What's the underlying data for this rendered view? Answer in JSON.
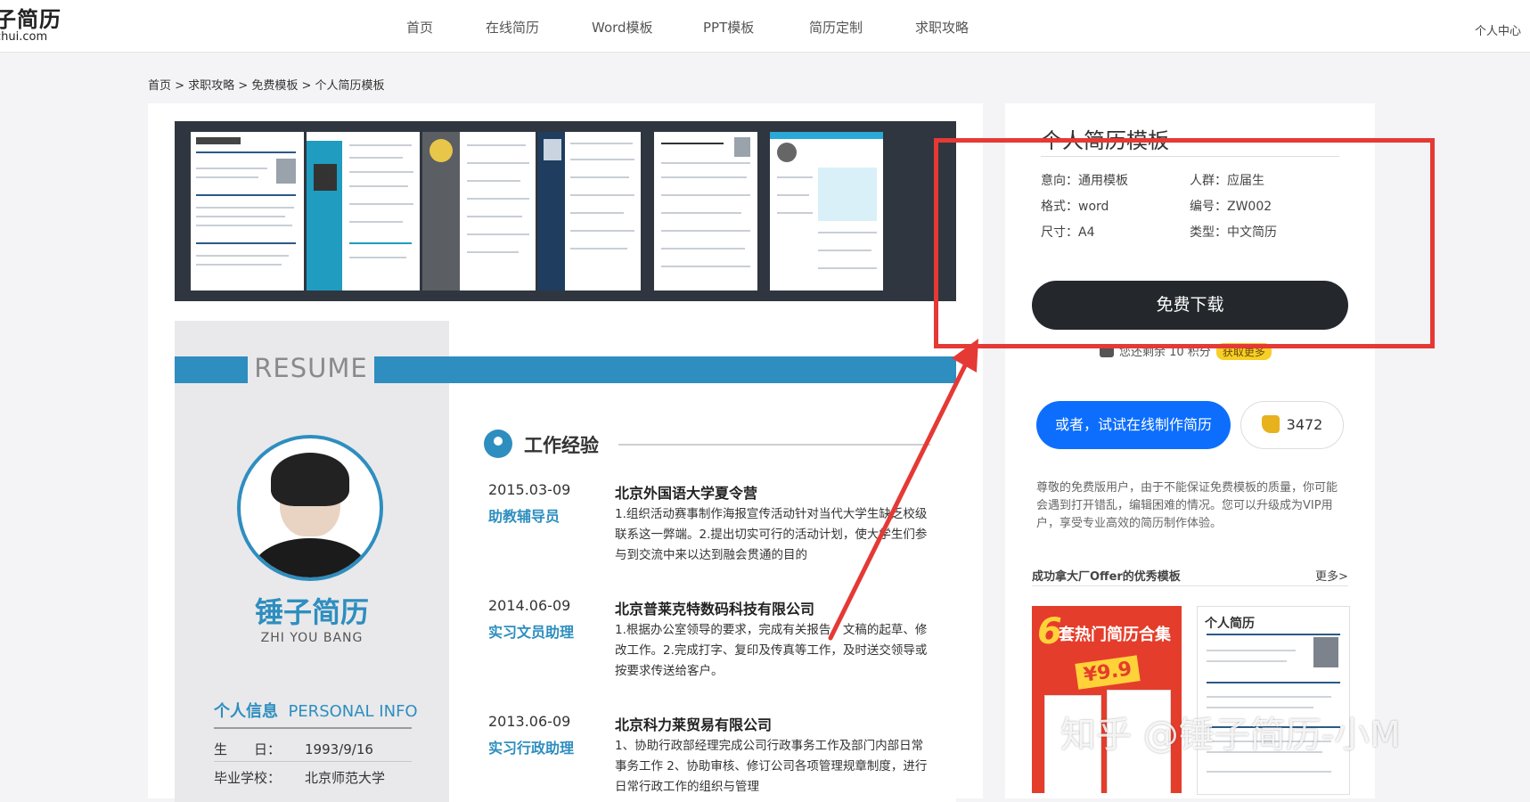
{
  "header": {
    "logo_cn": "子简历",
    "logo_en": "chui.com",
    "nav": [
      "首页",
      "在线简历",
      "Word模板",
      "PPT模板",
      "简历定制",
      "求职攻略"
    ],
    "user_center": "个人中心"
  },
  "breadcrumb": "首页 > 求职攻略 > 免费模板 > 个人简历模板",
  "preview": {
    "resume_word": "RESUME",
    "name": "锤子简历",
    "name_en": "ZHI YOU BANG",
    "info_title_cn": "个人信息",
    "info_title_en": "PERSONAL INFO",
    "info_rows": [
      {
        "k": "生　　日：",
        "v": "1993/9/16"
      },
      {
        "k": "毕业学校：",
        "v": "北京师范大学"
      }
    ],
    "section_title": "工作经验",
    "jobs": [
      {
        "date": "2015.03-09",
        "role": "助教辅导员",
        "company": "北京外国语大学夏令营",
        "desc": "1.组织活动赛事制作海报宣传活动针对当代大学生缺乏校级联系这一弊端。2.提出切实可行的活动计划，使大学生们参与到交流中来以达到融会贯通的目的"
      },
      {
        "date": "2014.06-09",
        "role": "实习文员助理",
        "company": "北京普莱克特数码科技有限公司",
        "desc": "1.根据办公室领导的要求，完成有关报告、文稿的起草、修改工作。2.完成打字、复印及传真等工作，及时送交领导或按要求传送给客户。"
      },
      {
        "date": "2013.06-09",
        "role": "实习行政助理",
        "company": "北京科力莱贸易有限公司",
        "desc": "1、协助行政部经理完成公司行政事务工作及部门内部日常事务工作 2、协助审核、修订公司各项管理规章制度，进行日常行政工作的组织与管理"
      }
    ]
  },
  "product": {
    "title": "个人简历模板",
    "meta": [
      {
        "text": "意向：通用模板"
      },
      {
        "text": "人群：应届生"
      },
      {
        "text": "格式：word"
      },
      {
        "text": "编号：ZW002"
      },
      {
        "text": "尺寸：A4"
      },
      {
        "text": "类型：中文简历"
      }
    ],
    "download_label": "免费下载",
    "quota_text": "您还剩余 10 积分",
    "quota_badge": "获取更多",
    "online_label": "或者，试试在线制作简历",
    "likes": "3472",
    "notice": "尊敬的免费版用户，由于不能保证免费模板的质量，你可能会遇到打开错乱，编辑困难的情况。您可以升级成为VIP用户，享受专业高效的简历制作体验。",
    "section_title": "成功拿大厂Offer的优秀模板",
    "more": "更多>",
    "card1_title": "套热门简历合集",
    "card1_number": "6",
    "card1_price": "¥9.9",
    "card2_title": "个人简历"
  },
  "watermark": "知乎 @锤子简历-小M",
  "colors": {
    "accent_blue": "#2e8ebf",
    "primary_button": "#24272c",
    "online_button": "#0d6efd",
    "annotation_red": "#e53935"
  }
}
